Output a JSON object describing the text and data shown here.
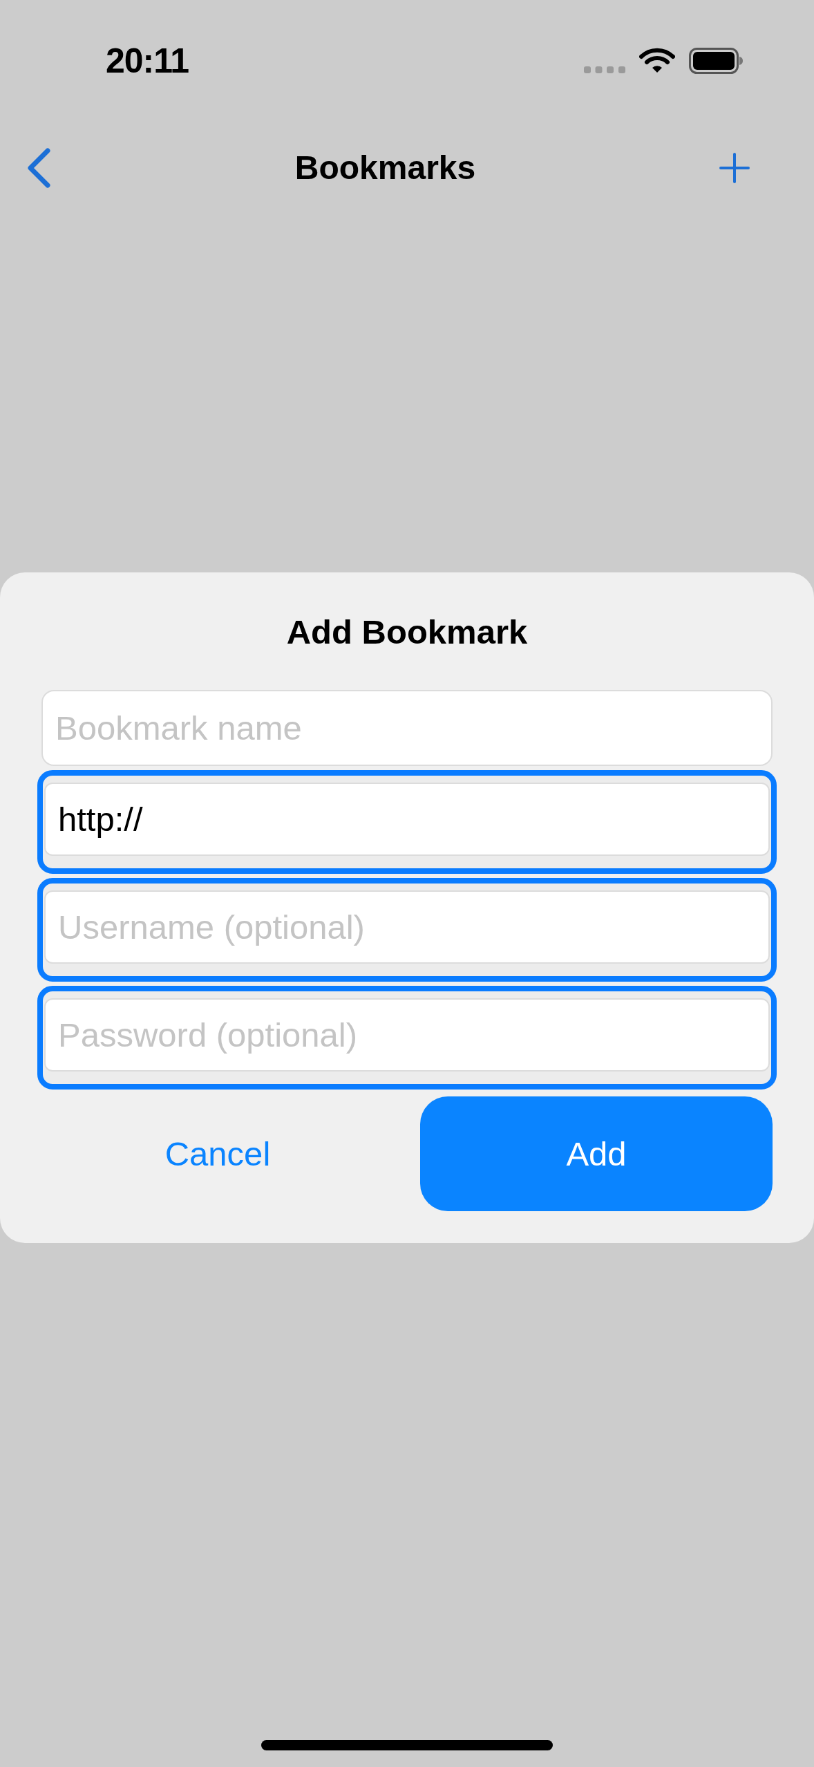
{
  "status_bar": {
    "time": "20:11"
  },
  "nav": {
    "title": "Bookmarks"
  },
  "dialog": {
    "title": "Add Bookmark",
    "fields": [
      {
        "placeholder": "Bookmark name",
        "highlighted": false
      },
      {
        "value": "http://",
        "highlighted": true
      },
      {
        "placeholder": "Username (optional)",
        "highlighted": true
      },
      {
        "placeholder": "Password (optional)",
        "highlighted": true
      }
    ],
    "buttons": [
      {
        "label": "Cancel",
        "kind": "secondary"
      },
      {
        "label": "Add",
        "kind": "primary"
      }
    ]
  }
}
